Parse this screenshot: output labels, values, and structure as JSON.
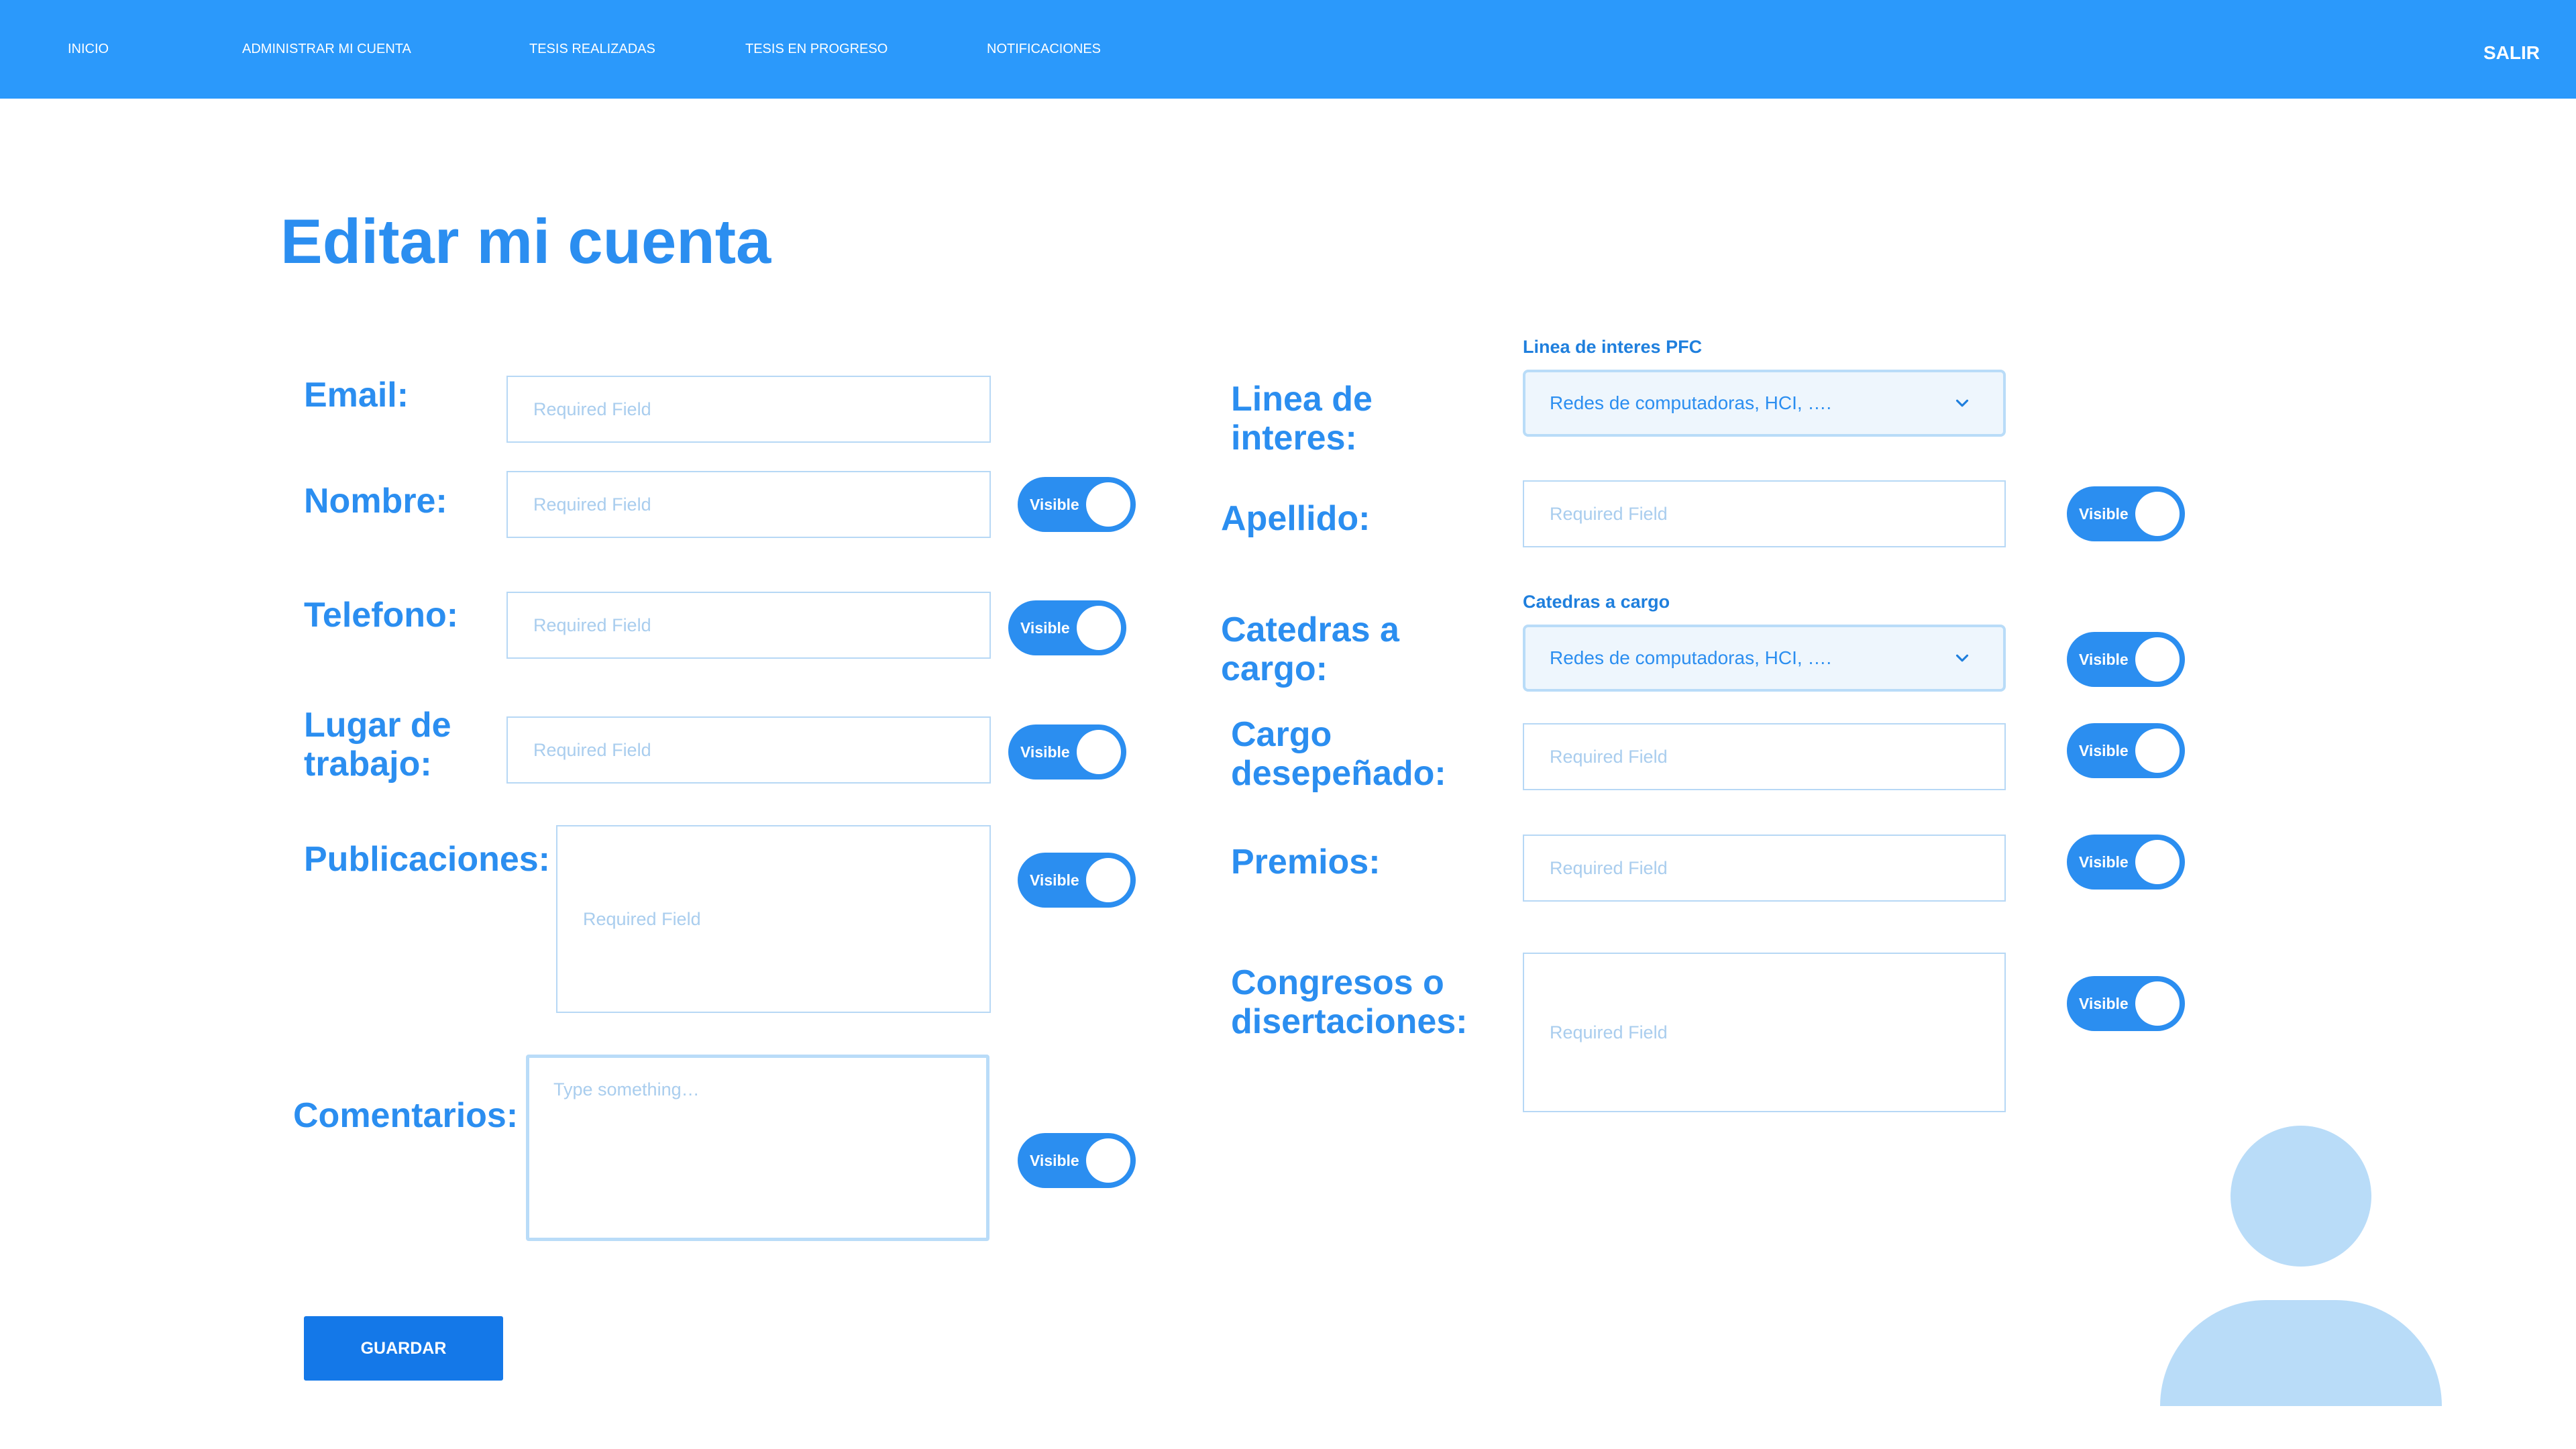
{
  "nav": {
    "items": [
      "INICIO",
      "ADMINISTRAR MI CUENTA",
      "TESIS REALIZADAS",
      "TESIS EN PROGRESO",
      "NOTIFICACIONES"
    ],
    "logout": "SALIR"
  },
  "page": {
    "title": "Editar mi cuenta"
  },
  "form": {
    "placeholder": "Required Field",
    "comment_placeholder": "Type something…",
    "toggle_label": "Visible",
    "email_label": "Email:",
    "nombre_label": "Nombre:",
    "telefono_label": "Telefono:",
    "lugar_label_1": "Lugar de",
    "lugar_label_2": "trabajo:",
    "publicaciones_label": "Publicaciones:",
    "comentarios_label": "Comentarios:",
    "linea_small": "Linea de interes PFC",
    "linea_label_1": "Linea de",
    "linea_label_2": "interes:",
    "linea_value": "Redes de computadoras, HCI, ….",
    "apellido_label": "Apellido:",
    "catedras_small": "Catedras a cargo",
    "catedras_label_1": "Catedras a",
    "catedras_label_2": "cargo:",
    "catedras_value": "Redes de computadoras, HCI, ….",
    "cargo_label_1": "Cargo",
    "cargo_label_2": "desepeñado:",
    "premios_label": "Premios:",
    "congresos_label_1": "Congresos o",
    "congresos_label_2": "disertaciones:",
    "save": "GUARDAR"
  },
  "colors": {
    "topbar": "#2b99fb",
    "accent": "#2b8ef0",
    "button": "#1478e8",
    "avatar": "#b9dcf8"
  },
  "icons": {
    "dropdown": "chevron-down-icon",
    "avatar": "user-avatar-icon"
  }
}
